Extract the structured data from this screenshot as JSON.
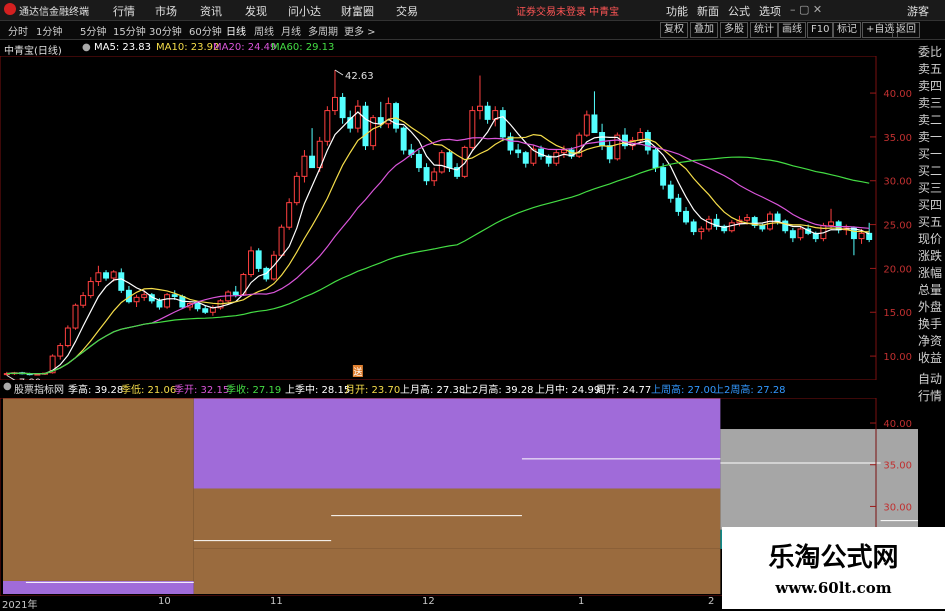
{
  "app": {
    "title": "通达信金融终端",
    "menu": [
      "行情",
      "市场",
      "资讯",
      "发现",
      "问小达",
      "财富圈",
      "交易"
    ],
    "notice": "证券交易未登录 中青宝",
    "right_menu": [
      "功能",
      "新面",
      "公式",
      "选项",
      "游客"
    ]
  },
  "toolbar": {
    "periods": [
      "分时",
      "1分钟",
      "5分钟",
      "15分钟",
      "30分钟",
      "60分钟",
      "日线",
      "周线",
      "月线",
      "多周期",
      "更多 >"
    ],
    "selected": "日线",
    "buttons": [
      "复权",
      "叠加",
      "多股",
      "统计",
      "画线",
      "F10",
      "标记",
      "+自选",
      "返回"
    ]
  },
  "main": {
    "stock_label": "中青宝(日线)",
    "ma": [
      {
        "label": "MA5: 23.83",
        "color": "#ffffff"
      },
      {
        "label": "MA10: 23.92",
        "color": "#f5dd4a"
      },
      {
        "label": "MA20: 24.49",
        "color": "#d955d9"
      },
      {
        "label": "MA60: 29.13",
        "color": "#44dd44"
      }
    ],
    "annot_high": "42.63",
    "annot_low": "7.80",
    "event_marker": "送"
  },
  "right_col": [
    "委比",
    "卖五",
    "卖四",
    "卖三",
    "卖二",
    "卖一",
    "买一",
    "买二",
    "买三",
    "买四",
    "买五",
    "现价",
    "涨跌",
    "涨幅",
    "总量",
    "外盘",
    "换手",
    "净资",
    "收益"
  ],
  "right_col_sub": [
    "自动",
    "行情"
  ],
  "sub": {
    "title": "股票指标网",
    "items": [
      {
        "label": "季高: 39.28",
        "color": "#ffffff"
      },
      {
        "label": "季低: 21.06",
        "color": "#f5dd4a"
      },
      {
        "label": "季开: 32.15",
        "color": "#d955d9"
      },
      {
        "label": "季收: 27.19",
        "color": "#44dd44"
      },
      {
        "label": "上季中: 28.15",
        "color": "#ffffff"
      },
      {
        "label": "月开: 23.70",
        "color": "#f5dd4a"
      },
      {
        "label": "上月高: 27.38",
        "color": "#ffffff"
      },
      {
        "label": "上2月高: 39.28",
        "color": "#ffffff"
      },
      {
        "label": "上月中: 24.99",
        "color": "#ffffff"
      },
      {
        "label": "周开: 24.77",
        "color": "#ffffff"
      },
      {
        "label": "上周高: 27.00",
        "color": "#3399ff"
      },
      {
        "label": "上2周高: 27.28",
        "color": "#3399ff"
      }
    ],
    "current_label": "23.96"
  },
  "x_axis": [
    "2021年",
    "10",
    "11",
    "12",
    "1",
    "2"
  ],
  "watermark": {
    "title": "乐淘公式网",
    "url": "www.60lt.com"
  },
  "chart_data": [
    {
      "type": "candlestick",
      "title": "中青宝(日线)",
      "y_ticks": [
        10,
        15,
        20,
        25,
        30,
        35,
        40
      ],
      "ylim": [
        7.5,
        44
      ],
      "x_tick_labels": [
        "2021年",
        "10",
        "11",
        "12",
        "1",
        "2"
      ],
      "ohlc": [
        [
          8.0,
          8.2,
          7.8,
          8.0
        ],
        [
          8.0,
          8.2,
          7.85,
          8.1
        ],
        [
          8.1,
          8.2,
          7.9,
          8.0
        ],
        [
          8.0,
          8.1,
          7.8,
          7.9
        ],
        [
          7.9,
          8.0,
          7.8,
          7.95
        ],
        [
          7.95,
          8.1,
          7.85,
          8.05
        ],
        [
          8.1,
          10.2,
          8.0,
          10.0
        ],
        [
          10.0,
          11.5,
          9.6,
          11.2
        ],
        [
          11.2,
          13.5,
          11.0,
          13.2
        ],
        [
          13.2,
          16.0,
          13.0,
          15.8
        ],
        [
          15.8,
          17.3,
          15.5,
          16.9
        ],
        [
          16.9,
          19.0,
          16.6,
          18.5
        ],
        [
          18.5,
          20.3,
          18.0,
          19.5
        ],
        [
          19.5,
          19.8,
          18.6,
          18.9
        ],
        [
          18.9,
          19.8,
          18.5,
          19.6
        ],
        [
          19.5,
          20.0,
          17.2,
          17.5
        ],
        [
          17.5,
          18.0,
          16.0,
          16.2
        ],
        [
          16.2,
          17.0,
          15.6,
          16.7
        ],
        [
          16.7,
          17.5,
          16.3,
          17.0
        ],
        [
          17.0,
          17.2,
          16.0,
          16.3
        ],
        [
          16.3,
          16.6,
          15.3,
          15.6
        ],
        [
          15.6,
          17.2,
          15.4,
          17.0
        ],
        [
          17.0,
          17.5,
          16.4,
          16.8
        ],
        [
          16.8,
          17.0,
          15.4,
          15.6
        ],
        [
          15.6,
          16.2,
          15.2,
          16.0
        ],
        [
          16.0,
          16.3,
          15.1,
          15.4
        ],
        [
          15.4,
          15.8,
          14.8,
          15.0
        ],
        [
          15.0,
          15.8,
          14.6,
          15.5
        ],
        [
          15.5,
          16.5,
          15.3,
          16.3
        ],
        [
          16.3,
          17.5,
          16.1,
          17.3
        ],
        [
          17.3,
          18.0,
          16.7,
          17.0
        ],
        [
          17.0,
          19.5,
          16.9,
          19.3
        ],
        [
          19.3,
          22.5,
          19.0,
          22.0
        ],
        [
          22.0,
          22.3,
          19.6,
          20.0
        ],
        [
          20.0,
          20.2,
          18.5,
          18.8
        ],
        [
          18.8,
          22.0,
          18.6,
          21.5
        ],
        [
          21.5,
          25.0,
          21.3,
          24.7
        ],
        [
          24.7,
          28.0,
          24.4,
          27.5
        ],
        [
          27.5,
          31.0,
          27.2,
          30.5
        ],
        [
          30.5,
          33.5,
          29.8,
          32.8
        ],
        [
          32.8,
          36.0,
          32.0,
          31.5
        ],
        [
          31.5,
          35.0,
          31.0,
          34.5
        ],
        [
          34.5,
          38.5,
          34.0,
          38.0
        ],
        [
          38.0,
          42.63,
          37.5,
          39.5
        ],
        [
          39.5,
          40.0,
          36.5,
          37.2
        ],
        [
          37.2,
          38.0,
          35.5,
          36.0
        ],
        [
          36.0,
          39.2,
          35.5,
          38.5
        ],
        [
          38.5,
          39.0,
          33.5,
          34.0
        ],
        [
          34.0,
          37.5,
          33.5,
          37.2
        ],
        [
          37.2,
          39.0,
          36.0,
          36.5
        ],
        [
          36.5,
          39.5,
          36.0,
          38.8
        ],
        [
          38.8,
          39.0,
          35.5,
          36.0
        ],
        [
          36.0,
          36.2,
          33.0,
          33.5
        ],
        [
          33.5,
          34.2,
          32.6,
          33.0
        ],
        [
          33.0,
          33.5,
          31.0,
          31.5
        ],
        [
          31.5,
          32.0,
          29.5,
          30.0
        ],
        [
          30.0,
          31.5,
          29.4,
          31.0
        ],
        [
          31.0,
          33.5,
          30.8,
          33.2
        ],
        [
          33.2,
          33.6,
          31.0,
          31.5
        ],
        [
          31.5,
          32.0,
          30.2,
          30.5
        ],
        [
          30.5,
          34.0,
          30.3,
          33.8
        ],
        [
          33.8,
          38.5,
          33.5,
          38.0
        ],
        [
          38.0,
          42.0,
          37.0,
          38.5
        ],
        [
          38.5,
          39.0,
          36.5,
          37.0
        ],
        [
          37.0,
          38.5,
          36.2,
          38.0
        ],
        [
          38.0,
          38.4,
          34.5,
          35.0
        ],
        [
          35.0,
          35.5,
          33.0,
          33.5
        ],
        [
          33.5,
          34.2,
          32.6,
          33.2
        ],
        [
          33.2,
          33.4,
          31.5,
          32.0
        ],
        [
          32.0,
          34.0,
          31.7,
          33.6
        ],
        [
          33.6,
          34.0,
          32.4,
          32.8
        ],
        [
          32.8,
          33.0,
          31.6,
          32.0
        ],
        [
          32.0,
          33.5,
          31.7,
          33.2
        ],
        [
          33.2,
          34.0,
          32.6,
          33.5
        ],
        [
          33.5,
          33.8,
          32.5,
          32.8
        ],
        [
          32.8,
          35.5,
          32.6,
          35.2
        ],
        [
          35.2,
          38.0,
          35.0,
          37.5
        ],
        [
          37.5,
          40.2,
          37.0,
          35.5
        ],
        [
          35.5,
          36.5,
          33.5,
          34.0
        ],
        [
          34.0,
          34.5,
          32.0,
          32.5
        ],
        [
          32.5,
          35.5,
          32.3,
          35.2
        ],
        [
          35.2,
          36.0,
          33.6,
          34.0
        ],
        [
          34.0,
          35.0,
          33.5,
          34.6
        ],
        [
          34.6,
          36.0,
          34.3,
          35.5
        ],
        [
          35.5,
          35.8,
          33.0,
          33.5
        ],
        [
          33.5,
          33.8,
          31.0,
          31.5
        ],
        [
          31.5,
          32.0,
          29.0,
          29.5
        ],
        [
          29.5,
          30.0,
          27.5,
          28.0
        ],
        [
          28.0,
          28.5,
          26.0,
          26.5
        ],
        [
          26.5,
          27.0,
          25.0,
          25.3
        ],
        [
          25.3,
          25.6,
          23.8,
          24.2
        ],
        [
          24.2,
          24.8,
          23.3,
          24.5
        ],
        [
          24.5,
          26.0,
          24.2,
          25.6
        ],
        [
          25.6,
          26.2,
          24.4,
          24.8
        ],
        [
          24.8,
          25.0,
          24.0,
          24.3
        ],
        [
          24.3,
          25.5,
          24.1,
          25.2
        ],
        [
          25.2,
          26.0,
          24.8,
          25.5
        ],
        [
          25.5,
          26.2,
          25.0,
          25.8
        ],
        [
          25.8,
          26.0,
          24.6,
          24.9
        ],
        [
          24.9,
          25.1,
          24.2,
          24.5
        ],
        [
          24.5,
          26.5,
          24.3,
          26.2
        ],
        [
          26.2,
          26.5,
          25.0,
          25.4
        ],
        [
          25.4,
          25.6,
          24.0,
          24.3
        ],
        [
          24.3,
          24.6,
          23.0,
          23.5
        ],
        [
          23.5,
          24.8,
          23.2,
          24.5
        ],
        [
          24.5,
          25.0,
          23.8,
          24.0
        ],
        [
          24.0,
          24.2,
          23.0,
          23.4
        ],
        [
          23.4,
          25.2,
          23.1,
          24.9
        ],
        [
          24.9,
          26.8,
          24.6,
          25.3
        ],
        [
          25.3,
          25.5,
          24.0,
          24.4
        ],
        [
          24.4,
          25.0,
          23.8,
          24.6
        ],
        [
          24.6,
          24.8,
          21.5,
          23.4
        ],
        [
          23.4,
          24.5,
          22.8,
          24.0
        ],
        [
          24.0,
          25.2,
          23.0,
          23.3
        ]
      ],
      "series": [
        {
          "name": "MA5",
          "value": 23.83
        },
        {
          "name": "MA10",
          "value": 23.92
        },
        {
          "name": "MA20",
          "value": 24.49
        },
        {
          "name": "MA60",
          "value": 29.13
        }
      ],
      "annotations": [
        {
          "label": "42.63"
        },
        {
          "label": "7.80"
        }
      ]
    },
    {
      "type": "step",
      "title": "股票指标网",
      "y_ticks": [
        20,
        25,
        30,
        35,
        40
      ],
      "ylim": [
        19.5,
        43
      ],
      "x_tick_labels": [
        "2021年",
        "10",
        "11",
        "12",
        "1",
        "2"
      ],
      "blocks": [
        {
          "i0": 0,
          "i1": 25,
          "top": 43,
          "bottom": 21.06,
          "color": "#9a6b3e"
        },
        {
          "i0": 25,
          "i1": 94,
          "top": 43,
          "bottom": 32.15,
          "color": "#a06bd9"
        },
        {
          "i0": 25,
          "i1": 94,
          "top": 32.15,
          "bottom": 25.0,
          "color": "#9a6b3e"
        },
        {
          "i0": 0,
          "i1": 25,
          "top": 21.06,
          "bottom": 19.5,
          "color": "#a06bd9"
        },
        {
          "i0": 25,
          "i1": 94,
          "top": 25.0,
          "bottom": 19.5,
          "color": "#9a6b3e"
        },
        {
          "i0": 94,
          "i1": 142,
          "top": 39.28,
          "bottom": 27.19,
          "color": "#a6a6a6"
        },
        {
          "i0": 94,
          "i1": 142,
          "top": 27.19,
          "bottom": 24.9,
          "color": "#108a8a"
        }
      ],
      "levels": [
        {
          "i0": 3,
          "i1": 25,
          "value": 20.9
        },
        {
          "i0": 25,
          "i1": 43,
          "value": 25.9
        },
        {
          "i0": 43,
          "i1": 68,
          "value": 28.9
        },
        {
          "i0": 68,
          "i1": 94,
          "value": 35.7
        },
        {
          "i0": 94,
          "i1": 115,
          "value": 35.2
        },
        {
          "i0": 115,
          "i1": 133,
          "value": 28.3
        },
        {
          "i0": 133,
          "i1": 142,
          "value": 28.5
        }
      ],
      "current": 23.96
    }
  ]
}
